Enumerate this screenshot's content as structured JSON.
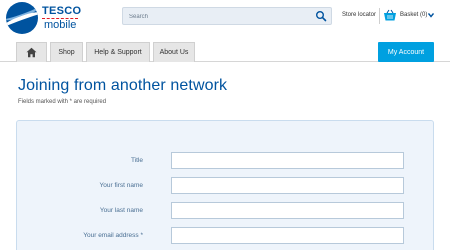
{
  "header": {
    "logo": {
      "brand_top": "TESCO",
      "brand_bottom": "mobile"
    },
    "search": {
      "placeholder": "Search"
    },
    "store_locator": "Store locator",
    "basket": "Basket (0)"
  },
  "nav": {
    "tabs": [
      {
        "label": "",
        "icon": "home-icon"
      },
      {
        "label": "Shop"
      },
      {
        "label": "Help & Support"
      },
      {
        "label": "About Us"
      }
    ],
    "account_button": "My Account"
  },
  "main": {
    "title": "Joining from another network",
    "required_note": "Fields marked with * are required",
    "form": {
      "fields": [
        {
          "label": "Title",
          "value": ""
        },
        {
          "label": "Your first name",
          "value": ""
        },
        {
          "label": "Your last name",
          "value": ""
        },
        {
          "label": "Your email address *",
          "value": ""
        }
      ]
    }
  },
  "colors": {
    "brand_blue": "#00539f",
    "account_button": "#00a0e0",
    "panel_bg": "#eef4fb",
    "tab_bg": "#e6e6e6"
  }
}
